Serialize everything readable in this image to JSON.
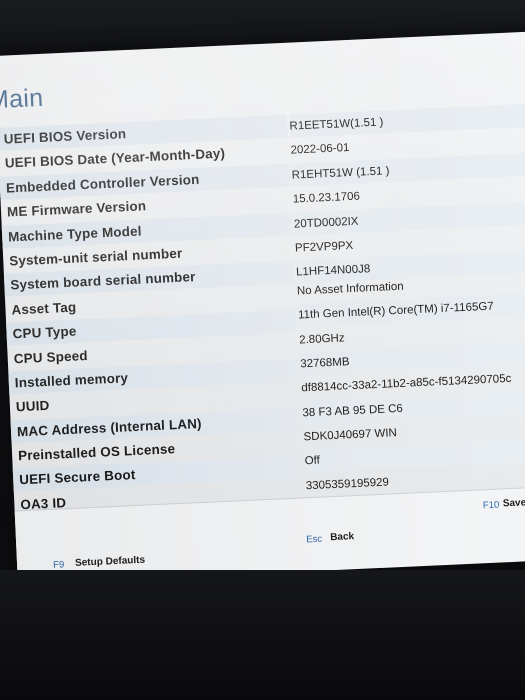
{
  "page": {
    "title": "Main"
  },
  "info": [
    {
      "label": "UEFI BIOS Version",
      "value": "R1EET51W(1.51 )"
    },
    {
      "label": "UEFI BIOS Date (Year-Month-Day)",
      "value": "2022-06-01"
    },
    {
      "label": "Embedded Controller Version",
      "value": "R1EHT51W (1.51 )"
    },
    {
      "label": "ME Firmware Version",
      "value": "15.0.23.1706"
    },
    {
      "label": "Machine Type Model",
      "value": "20TD0002IX"
    },
    {
      "label": "System-unit serial number",
      "value": "PF2VP9PX"
    },
    {
      "label": "System board serial number",
      "value": "L1HF14N00J8"
    },
    {
      "label": "Asset Tag",
      "value": "No Asset Information"
    },
    {
      "label": "CPU Type",
      "value": "11th Gen Intel(R) Core(TM) i7-1165G7"
    },
    {
      "label": "CPU Speed",
      "value": "2.80GHz"
    },
    {
      "label": "Installed memory",
      "value": "32768MB"
    },
    {
      "label": "UUID",
      "value": "df8814cc-33a2-11b2-a85c-f5134290705c"
    },
    {
      "label": "MAC Address (Internal LAN)",
      "value": "38 F3 AB 95 DE C6"
    },
    {
      "label": "Preinstalled OS License",
      "value": "SDK0J40697 WIN"
    },
    {
      "label": "UEFI Secure Boot",
      "value": "Off"
    },
    {
      "label": "OA3 ID",
      "value": "3305359195929"
    }
  ],
  "footer": {
    "f9_key": "F9",
    "f9_label": "Setup Defaults",
    "esc_key": "Esc",
    "esc_label": "Back",
    "f10_key": "F10",
    "f10_label": "Save and"
  },
  "colors": {
    "title": "#3b5f8a",
    "key": "#2e67a9",
    "screen_bg": "#f4f5f6",
    "row_stripe": "#e4ebf2"
  }
}
